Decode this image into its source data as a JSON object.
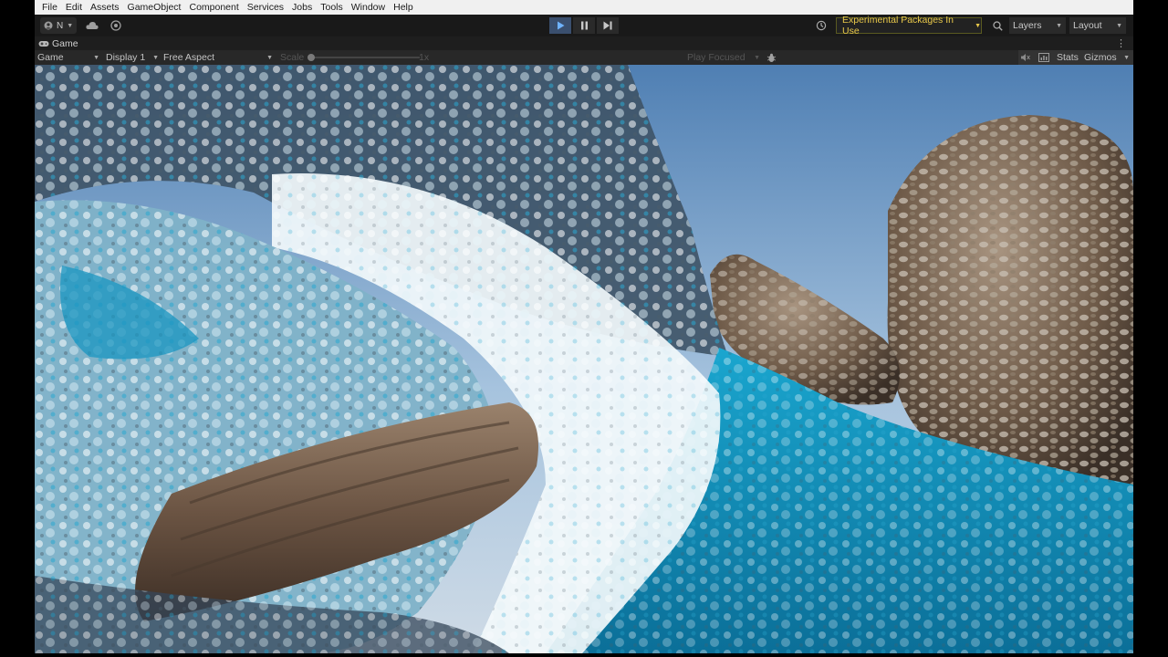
{
  "menu": {
    "items": [
      "File",
      "Edit",
      "Assets",
      "GameObject",
      "Component",
      "Services",
      "Jobs",
      "Tools",
      "Window",
      "Help"
    ]
  },
  "toolbar": {
    "account_initial": "N",
    "experimental_label": "Experimental Packages In Use",
    "layers_label": "Layers",
    "layout_label": "Layout"
  },
  "tab": {
    "label": "Game"
  },
  "gamebar": {
    "mode": "Game",
    "display": "Display 1",
    "aspect": "Free Aspect",
    "scale_label": "Scale",
    "scale_value": "1x",
    "play_mode": "Play Focused",
    "stats_label": "Stats",
    "gizmos_label": "Gizmos"
  },
  "colors": {
    "accent_play": "#3a4f6e",
    "experimental_text": "#e8c84a",
    "water": "#1f9fc4",
    "foam": "#e6f1f5",
    "rock": "#7a6654",
    "sky": "#8fb5d8"
  },
  "icons": [
    "account-icon",
    "cloud-icon",
    "collab-icon",
    "play-icon",
    "pause-icon",
    "step-icon",
    "history-icon",
    "search-icon",
    "gamepad-icon",
    "bug-icon",
    "audio-mute-icon",
    "stats-icon",
    "kebab-icon"
  ]
}
